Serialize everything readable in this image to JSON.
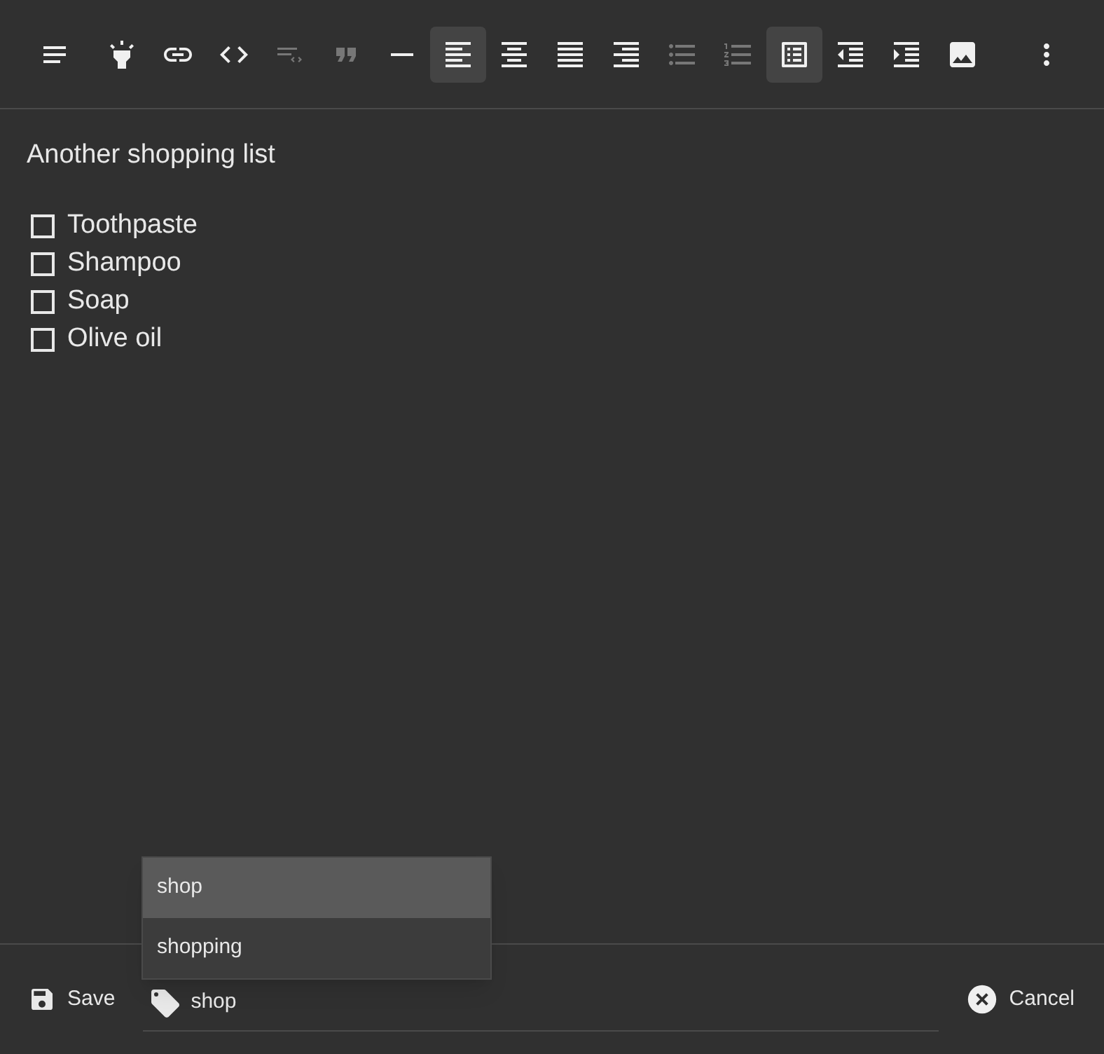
{
  "toolbar": [
    {
      "kind": "format",
      "selected": false,
      "disabled": false
    },
    {
      "kind": "highlight",
      "selected": false,
      "disabled": false
    },
    {
      "kind": "link",
      "selected": false,
      "disabled": false
    },
    {
      "kind": "code",
      "selected": false,
      "disabled": false
    },
    {
      "kind": "codeblock",
      "selected": false,
      "disabled": true
    },
    {
      "kind": "quote",
      "selected": false,
      "disabled": true
    },
    {
      "kind": "rule",
      "selected": false,
      "disabled": false
    },
    {
      "kind": "alignleft",
      "selected": true,
      "disabled": false
    },
    {
      "kind": "aligncenter",
      "selected": false,
      "disabled": false
    },
    {
      "kind": "justify",
      "selected": false,
      "disabled": false
    },
    {
      "kind": "alignright",
      "selected": false,
      "disabled": false
    },
    {
      "kind": "bullets",
      "selected": false,
      "disabled": true
    },
    {
      "kind": "numbers",
      "selected": false,
      "disabled": true
    },
    {
      "kind": "checklist",
      "selected": true,
      "disabled": false
    },
    {
      "kind": "outdent",
      "selected": false,
      "disabled": false
    },
    {
      "kind": "indent",
      "selected": false,
      "disabled": false
    },
    {
      "kind": "image",
      "selected": false,
      "disabled": false
    },
    {
      "kind": "more",
      "selected": false,
      "disabled": false
    }
  ],
  "note": {
    "title": "Another shopping list",
    "items": [
      {
        "text": "Toothpaste",
        "checked": false
      },
      {
        "text": "Shampoo",
        "checked": false
      },
      {
        "text": "Soap",
        "checked": false
      },
      {
        "text": "Olive oil",
        "checked": false
      }
    ]
  },
  "footer": {
    "save": "Save",
    "tag_value": "shop",
    "cancel": "Cancel",
    "suggestions": [
      {
        "text": "shop",
        "selected": true
      },
      {
        "text": "shopping",
        "selected": false
      }
    ]
  }
}
